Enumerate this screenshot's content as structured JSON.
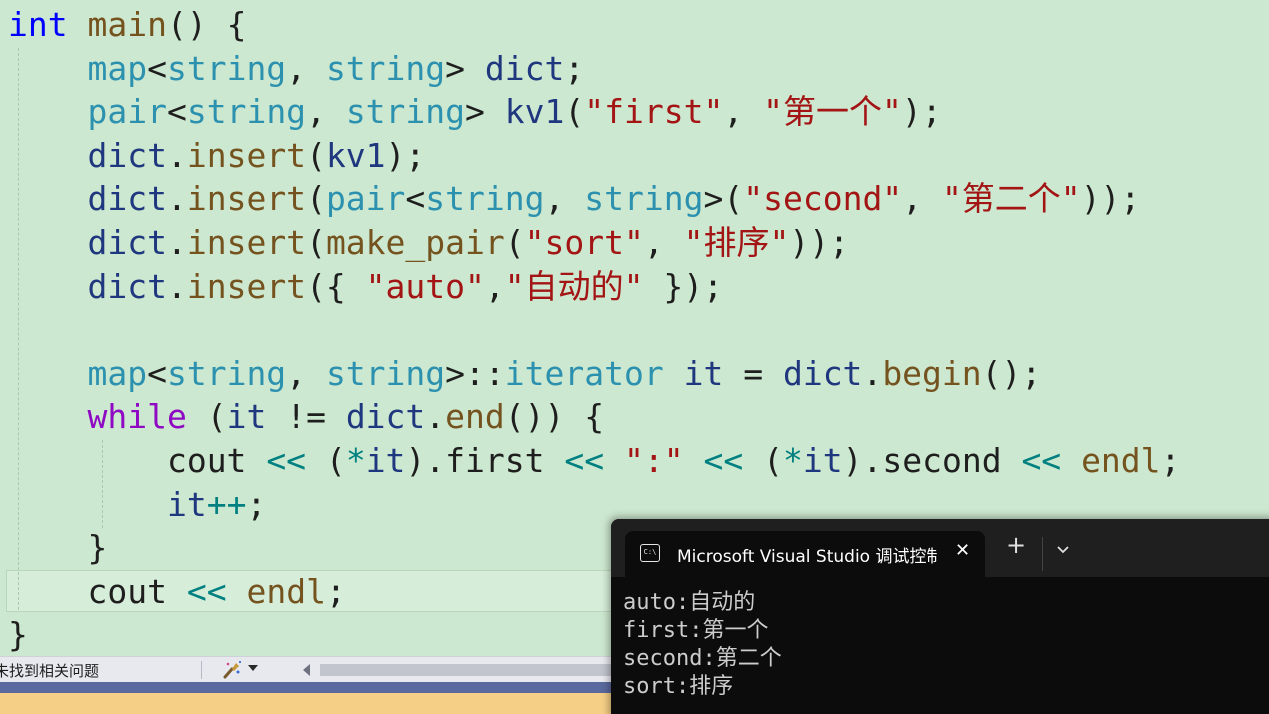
{
  "editor": {
    "lines": [
      [
        {
          "t": "int",
          "c": "kw"
        },
        {
          "t": " ",
          "c": "pl"
        },
        {
          "t": "main",
          "c": "fn"
        },
        {
          "t": "() {",
          "c": "pl"
        }
      ],
      [
        {
          "t": "    ",
          "c": "pl"
        },
        {
          "t": "map",
          "c": "ty"
        },
        {
          "t": "<",
          "c": "pl"
        },
        {
          "t": "string",
          "c": "ty"
        },
        {
          "t": ", ",
          "c": "pl"
        },
        {
          "t": "string",
          "c": "ty"
        },
        {
          "t": "> ",
          "c": "pl"
        },
        {
          "t": "dict",
          "c": "var"
        },
        {
          "t": ";",
          "c": "pl"
        }
      ],
      [
        {
          "t": "    ",
          "c": "pl"
        },
        {
          "t": "pair",
          "c": "ty"
        },
        {
          "t": "<",
          "c": "pl"
        },
        {
          "t": "string",
          "c": "ty"
        },
        {
          "t": ", ",
          "c": "pl"
        },
        {
          "t": "string",
          "c": "ty"
        },
        {
          "t": "> ",
          "c": "pl"
        },
        {
          "t": "kv1",
          "c": "var"
        },
        {
          "t": "(",
          "c": "pl"
        },
        {
          "t": "\"first\"",
          "c": "str"
        },
        {
          "t": ", ",
          "c": "pl"
        },
        {
          "t": "\"第一个\"",
          "c": "str"
        },
        {
          "t": ");",
          "c": "pl"
        }
      ],
      [
        {
          "t": "    ",
          "c": "pl"
        },
        {
          "t": "dict",
          "c": "var"
        },
        {
          "t": ".",
          "c": "pl"
        },
        {
          "t": "insert",
          "c": "fn"
        },
        {
          "t": "(",
          "c": "pl"
        },
        {
          "t": "kv1",
          "c": "var"
        },
        {
          "t": ");",
          "c": "pl"
        }
      ],
      [
        {
          "t": "    ",
          "c": "pl"
        },
        {
          "t": "dict",
          "c": "var"
        },
        {
          "t": ".",
          "c": "pl"
        },
        {
          "t": "insert",
          "c": "fn"
        },
        {
          "t": "(",
          "c": "pl"
        },
        {
          "t": "pair",
          "c": "ty"
        },
        {
          "t": "<",
          "c": "pl"
        },
        {
          "t": "string",
          "c": "ty"
        },
        {
          "t": ", ",
          "c": "pl"
        },
        {
          "t": "string",
          "c": "ty"
        },
        {
          "t": ">(",
          "c": "pl"
        },
        {
          "t": "\"second\"",
          "c": "str"
        },
        {
          "t": ", ",
          "c": "pl"
        },
        {
          "t": "\"第二个\"",
          "c": "str"
        },
        {
          "t": "));",
          "c": "pl"
        }
      ],
      [
        {
          "t": "    ",
          "c": "pl"
        },
        {
          "t": "dict",
          "c": "var"
        },
        {
          "t": ".",
          "c": "pl"
        },
        {
          "t": "insert",
          "c": "fn"
        },
        {
          "t": "(",
          "c": "pl"
        },
        {
          "t": "make_pair",
          "c": "fn"
        },
        {
          "t": "(",
          "c": "pl"
        },
        {
          "t": "\"sort\"",
          "c": "str"
        },
        {
          "t": ", ",
          "c": "pl"
        },
        {
          "t": "\"排序\"",
          "c": "str"
        },
        {
          "t": "));",
          "c": "pl"
        }
      ],
      [
        {
          "t": "    ",
          "c": "pl"
        },
        {
          "t": "dict",
          "c": "var"
        },
        {
          "t": ".",
          "c": "pl"
        },
        {
          "t": "insert",
          "c": "fn"
        },
        {
          "t": "({ ",
          "c": "pl"
        },
        {
          "t": "\"auto\"",
          "c": "str"
        },
        {
          "t": ",",
          "c": "pl"
        },
        {
          "t": "\"自动的\"",
          "c": "str"
        },
        {
          "t": " });",
          "c": "pl"
        }
      ],
      [],
      [
        {
          "t": "    ",
          "c": "pl"
        },
        {
          "t": "map",
          "c": "ty"
        },
        {
          "t": "<",
          "c": "pl"
        },
        {
          "t": "string",
          "c": "ty"
        },
        {
          "t": ", ",
          "c": "pl"
        },
        {
          "t": "string",
          "c": "ty"
        },
        {
          "t": ">::",
          "c": "pl"
        },
        {
          "t": "iterator",
          "c": "ty"
        },
        {
          "t": " ",
          "c": "pl"
        },
        {
          "t": "it",
          "c": "var"
        },
        {
          "t": " = ",
          "c": "pl"
        },
        {
          "t": "dict",
          "c": "var"
        },
        {
          "t": ".",
          "c": "pl"
        },
        {
          "t": "begin",
          "c": "fn"
        },
        {
          "t": "();",
          "c": "pl"
        }
      ],
      [
        {
          "t": "    ",
          "c": "pl"
        },
        {
          "t": "while",
          "c": "ctl"
        },
        {
          "t": " (",
          "c": "pl"
        },
        {
          "t": "it",
          "c": "var"
        },
        {
          "t": " != ",
          "c": "pl"
        },
        {
          "t": "dict",
          "c": "var"
        },
        {
          "t": ".",
          "c": "pl"
        },
        {
          "t": "end",
          "c": "fn"
        },
        {
          "t": "()) {",
          "c": "pl"
        }
      ],
      [
        {
          "t": "        ",
          "c": "pl"
        },
        {
          "t": "cout",
          "c": "pl"
        },
        {
          "t": " ",
          "c": "pl"
        },
        {
          "t": "<<",
          "c": "op"
        },
        {
          "t": " (",
          "c": "pl"
        },
        {
          "t": "*",
          "c": "op"
        },
        {
          "t": "it",
          "c": "var"
        },
        {
          "t": ").first ",
          "c": "pl"
        },
        {
          "t": "<<",
          "c": "op"
        },
        {
          "t": " ",
          "c": "pl"
        },
        {
          "t": "\":\"",
          "c": "str"
        },
        {
          "t": " ",
          "c": "pl"
        },
        {
          "t": "<<",
          "c": "op"
        },
        {
          "t": " (",
          "c": "pl"
        },
        {
          "t": "*",
          "c": "op"
        },
        {
          "t": "it",
          "c": "var"
        },
        {
          "t": ").second ",
          "c": "pl"
        },
        {
          "t": "<<",
          "c": "op"
        },
        {
          "t": " ",
          "c": "pl"
        },
        {
          "t": "endl",
          "c": "fn"
        },
        {
          "t": ";",
          "c": "pl"
        }
      ],
      [
        {
          "t": "        ",
          "c": "pl"
        },
        {
          "t": "it",
          "c": "var"
        },
        {
          "t": "++",
          "c": "op"
        },
        {
          "t": ";",
          "c": "pl"
        }
      ],
      [
        {
          "t": "    }",
          "c": "pl"
        }
      ],
      [
        {
          "t": "    ",
          "c": "pl"
        },
        {
          "t": "cout",
          "c": "pl"
        },
        {
          "t": " ",
          "c": "pl"
        },
        {
          "t": "<<",
          "c": "op"
        },
        {
          "t": " ",
          "c": "pl"
        },
        {
          "t": "endl",
          "c": "fn"
        },
        {
          "t": ";",
          "c": "pl"
        }
      ],
      [
        {
          "t": "}",
          "c": "pl"
        }
      ]
    ]
  },
  "status_bar": {
    "issues_text": "未找到相关问题"
  },
  "console": {
    "tab_title": "Microsoft Visual Studio 调试控制台",
    "tab_icon_text": "C:\\",
    "close_symbol": "✕",
    "new_tab_symbol": "+",
    "output_lines": [
      "auto:自动的",
      "first:第一个",
      "second:第二个",
      "sort:排序"
    ]
  },
  "colors": {
    "editor_background": "#cde8d0",
    "keyword": "#0000ff",
    "control_keyword": "#8f08c4",
    "function": "#74531f",
    "type": "#2b91af",
    "variable": "#1f377f",
    "string": "#a31515",
    "operator": "#008080",
    "console_background": "#0c0c0c"
  },
  "icons": [
    "terminal-icon",
    "close-icon",
    "plus-icon",
    "chevron-down-icon",
    "brush-icon",
    "scroll-left-arrow-icon"
  ]
}
